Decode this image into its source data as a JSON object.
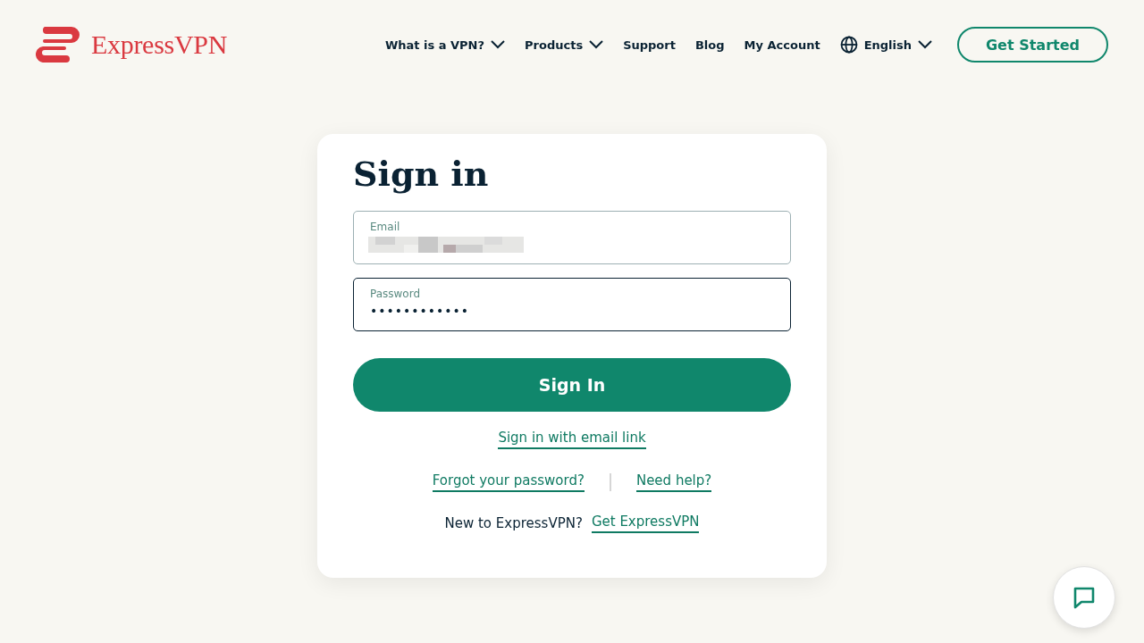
{
  "brand": {
    "name": "ExpressVPN"
  },
  "nav": [
    {
      "label": "What is a VPN?",
      "kind": "menu",
      "dropdown": true
    },
    {
      "label": "Products",
      "kind": "menu",
      "dropdown": true
    },
    {
      "label": "Support",
      "kind": "menu",
      "dropdown": false
    },
    {
      "label": "Blog",
      "kind": "menu",
      "dropdown": false
    },
    {
      "label": "My Account",
      "kind": "menu",
      "dropdown": false
    },
    {
      "label": "English",
      "kind": "language",
      "dropdown": true
    }
  ],
  "cta": "Get Started",
  "signin": {
    "title": "Sign in",
    "fields": [
      {
        "label": "Email",
        "kind": "redacted",
        "focused": false
      },
      {
        "label": "Password",
        "kind": "text",
        "value": "••••••••••••",
        "focused": true
      }
    ],
    "submit": "Sign In",
    "email_link": "Sign in with email link",
    "help_links": [
      "Forgot your password?",
      "Need help?"
    ],
    "new_prompt": "New to ExpressVPN?",
    "new_link": "Get ExpressVPN"
  }
}
